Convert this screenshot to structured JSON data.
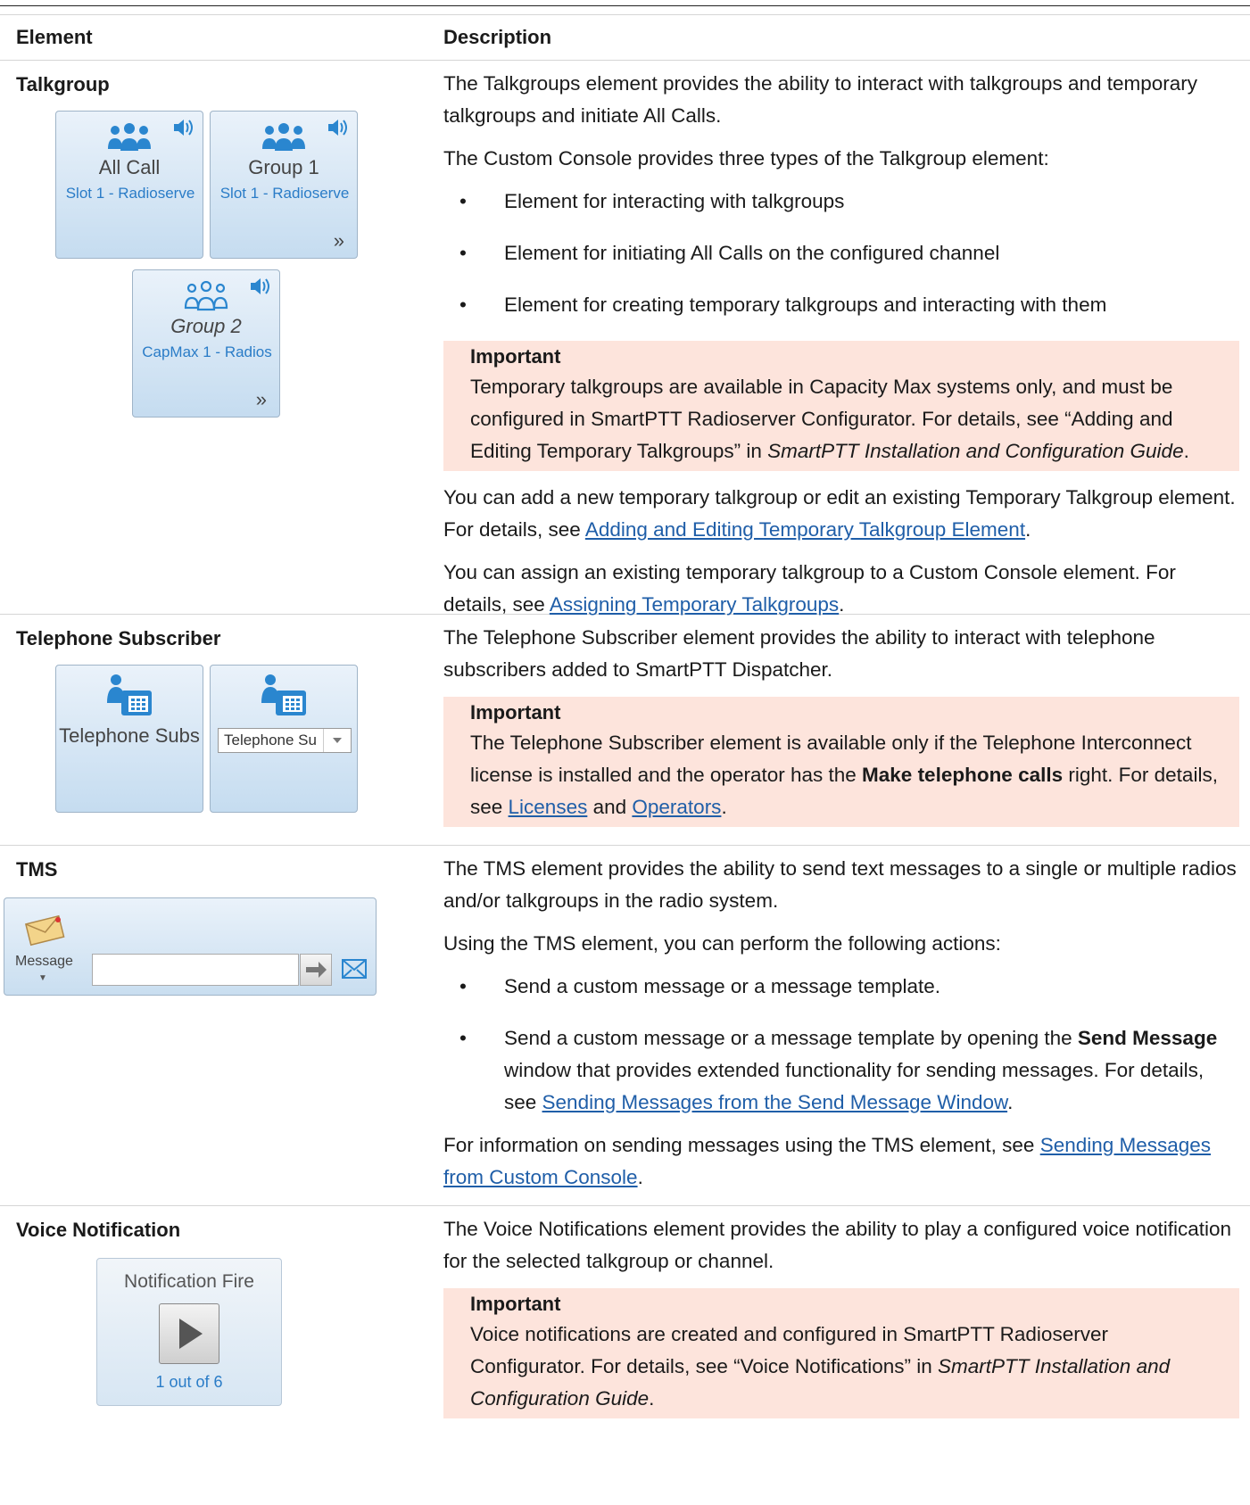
{
  "header": {
    "element": "Element",
    "description": "Description"
  },
  "rows": {
    "talkgroup": {
      "name": "Talkgroup",
      "widgets": {
        "all_call": {
          "name": "All Call",
          "sub": "Slot 1 - Radioserve"
        },
        "group1": {
          "name": "Group 1",
          "sub": "Slot 1 - Radioserve"
        },
        "group2": {
          "name": "Group 2",
          "sub": "CapMax 1 - Radios"
        }
      },
      "p1": "The Talkgroups element provides the ability to interact with talkgroups and temporary talkgroups and initiate All Calls.",
      "p2": "The Custom Console provides three types of the Talkgroup element:",
      "bullets": [
        "Element for interacting with talkgroups",
        "Element for initiating All Calls on the configured channel",
        "Element for creating temporary talkgroups and interacting with them"
      ],
      "note_title": "Important",
      "note_a": "Temporary talkgroups are available in Capacity Max systems only, and must be configured in SmartPTT Radioserver Configurator. For details, see “Adding and Editing Temporary Talkgroups” in ",
      "note_i": "SmartPTT Installation and Configuration Guide",
      "note_b": ".",
      "p3_a": "You can add a new temporary talkgroup or edit an existing Temporary Talkgroup element. For details, see ",
      "p3_link": "Adding and Editing Temporary Talkgroup Element",
      "p3_b": ".",
      "p4_a": "You can assign an existing temporary talkgroup to a Custom Console element. For details, see ",
      "p4_link": "Assigning Temporary Talkgroups",
      "p4_b": "."
    },
    "telephone": {
      "name": "Telephone Subscriber",
      "widgets": {
        "tile1": "Telephone Subs",
        "tile2_combo": "Telephone Su"
      },
      "p1": "The Telephone Subscriber element provides the ability to interact with telephone subscribers added to SmartPTT Dispatcher.",
      "note_title": "Important",
      "note_a": "The Telephone Subscriber element is available only if the Telephone Interconnect license is installed and the operator has the ",
      "note_bold": "Make telephone calls",
      "note_b": " right. For details, see ",
      "note_link1": "Licenses",
      "note_and": " and ",
      "note_link2": "Operators",
      "note_c": "."
    },
    "tms": {
      "name": "TMS",
      "widget_label": "Message",
      "p1": "The TMS element provides the ability to send text messages to a single or multiple radios and/or talkgroups in the radio system.",
      "p2": "Using the TMS element, you can perform the following actions:",
      "b1": "Send a custom message or a message template.",
      "b2_a": "Send a custom message or a message template by opening the ",
      "b2_bold": "Send Message",
      "b2_b": " window that provides extended functionality for sending messages. For details, see ",
      "b2_link": "Sending Messages from the Send Message Window",
      "b2_c": ".",
      "p3_a": "For information on sending messages using the TMS element, see ",
      "p3_link": "Sending Messages from Custom Console",
      "p3_b": "."
    },
    "voice": {
      "name": "Voice Notification",
      "widget_title": "Notification Fire",
      "widget_counter": "1 out of 6",
      "p1": "The Voice Notifications element provides the ability to play a configured voice notification for the selected talkgroup or channel.",
      "note_title": "Important",
      "note_a": "Voice notifications are created and configured in SmartPTT Radioserver Configurator. For details, see “Voice Notifications” in ",
      "note_i": "SmartPTT Installation and Configuration Guide",
      "note_b": "."
    }
  },
  "colors": {
    "accent_blue": "#2a7cc7",
    "link": "#1f5ea8",
    "note_bg": "#fde4dc"
  }
}
